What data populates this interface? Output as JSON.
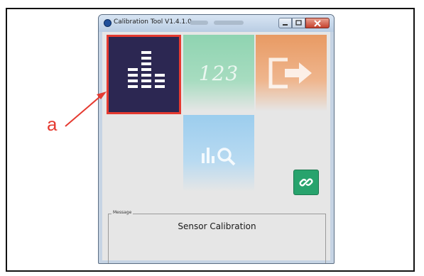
{
  "window": {
    "title": "Calibration Tool V1.4.1.0"
  },
  "tiles": [
    {
      "name": "calibration",
      "icon": "equalizer-bars-icon"
    },
    {
      "name": "numbers",
      "icon": "numbers-123-icon",
      "glyph": "123"
    },
    {
      "name": "exit",
      "icon": "exit-arrow-icon"
    },
    {
      "name": "data-search",
      "icon": "chart-search-icon"
    }
  ],
  "link_button": {
    "icon": "link-icon"
  },
  "message": {
    "legend": "Message",
    "text": "Sensor Calibration"
  },
  "callout": {
    "label": "a",
    "color": "#e53a30"
  },
  "colors": {
    "main_tile": "#2c2752",
    "numbers_tile": "#8fd4b1",
    "exit_tile": "#e89a63",
    "search_tile": "#9ccdee",
    "link_button": "#28a36d"
  }
}
